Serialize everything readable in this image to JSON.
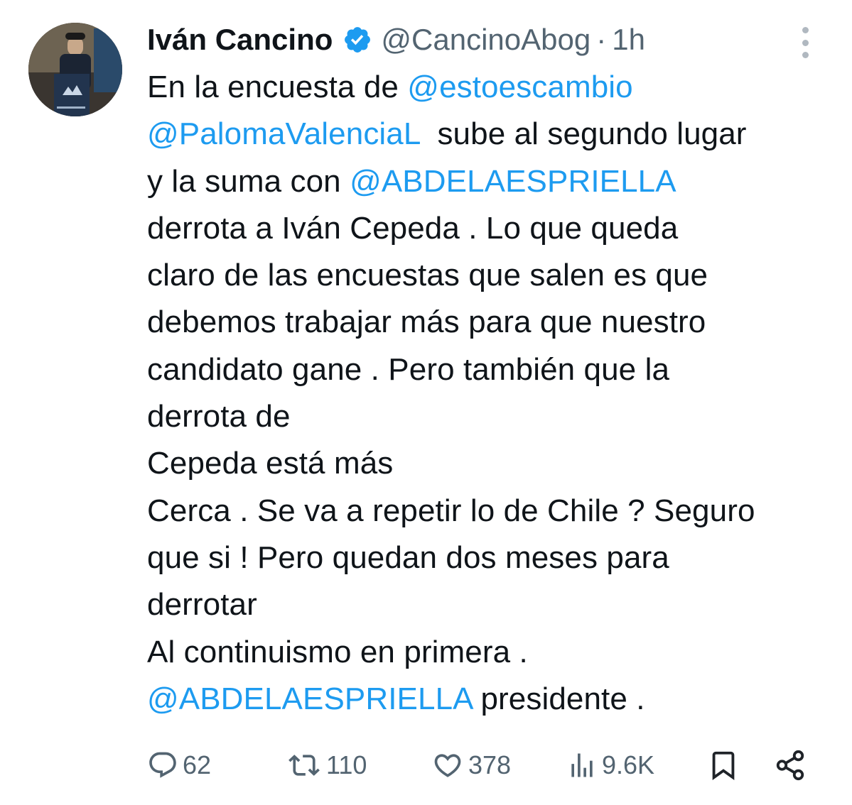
{
  "author": {
    "name": "Iván Cancino",
    "handle": "@CancinoAbog",
    "separator": "·",
    "time": "1h",
    "avatar_icon": "profile-photo"
  },
  "tweet": {
    "segments": [
      {
        "type": "text",
        "text": "En la encuesta de "
      },
      {
        "type": "mention",
        "text": "@estoescambio"
      },
      {
        "type": "text",
        "text": "\n"
      },
      {
        "type": "mention",
        "text": "@PalomaValenciaL"
      },
      {
        "type": "text",
        "text": "  sube al segundo lugar\ny la suma con "
      },
      {
        "type": "mention",
        "text": "@ABDELAESPRIELLA"
      },
      {
        "type": "text",
        "text": "\nderrota a Iván Cepeda . Lo que queda\nclaro de las encuestas que salen es que\ndebemos trabajar más para que nuestro\ncandidato gane . Pero también que la\nderrota de\nCepeda está más\nCerca . Se va a repetir lo de Chile ? Seguro\nque si ! Pero quedan dos meses para\nderrotar\nAl continuismo en primera .\n"
      },
      {
        "type": "mention",
        "text": "@ABDELAESPRIELLA"
      },
      {
        "type": "text",
        "text": " presidente ."
      }
    ]
  },
  "actions": {
    "replies": "62",
    "reposts": "110",
    "likes": "378",
    "views": "9.6K"
  },
  "colors": {
    "mention": "#1d9bf0",
    "secondary_text": "#536471",
    "verified_badge": "#1d9bf0"
  }
}
